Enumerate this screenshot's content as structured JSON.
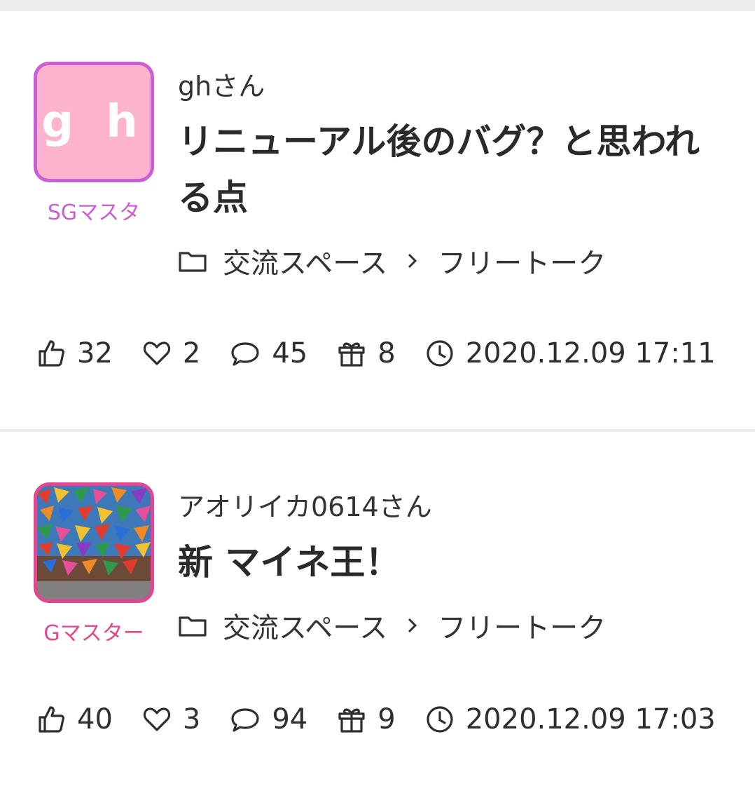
{
  "posts": [
    {
      "avatar_initials": "g h",
      "rank": "SGマスタ",
      "author": "ghさん",
      "title": "リニューアル後のバグ？と思われる点",
      "category": "交流スペース",
      "subcategory": "フリートーク",
      "likes": "32",
      "hearts": "2",
      "comments": "45",
      "gifts": "8",
      "datetime": "2020.12.09 17:11"
    },
    {
      "rank": "Gマスター",
      "author": "アオリイカ0614さん",
      "title": "新 マイネ王！",
      "category": "交流スペース",
      "subcategory": "フリートーク",
      "likes": "40",
      "hearts": "3",
      "comments": "94",
      "gifts": "9",
      "datetime": "2020.12.09 17:03"
    }
  ],
  "colors": {
    "rank_purple": "#c95fd2",
    "rank_pink": "#e6458f",
    "avatar_bg": "#fdb3cd"
  },
  "icons": [
    "folder-icon",
    "chevron-right-icon",
    "thumbs-up-icon",
    "heart-icon",
    "comment-icon",
    "gift-icon",
    "clock-icon"
  ]
}
